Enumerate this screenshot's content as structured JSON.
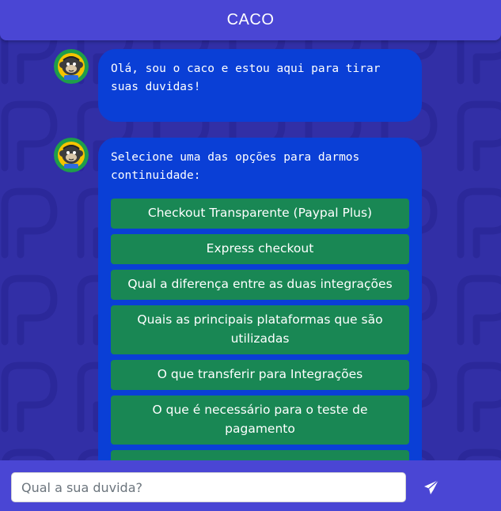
{
  "header": {
    "title": "CACO"
  },
  "messages": [
    {
      "text": "Olá, sou o caco e estou aqui para tirar suas duvidas!"
    },
    {
      "text": "Selecione uma das opções para darmos continuidade:",
      "options": [
        "Checkout Transparente (Paypal Plus)",
        "Express checkout",
        "Qual a diferença entre as duas integrações",
        "Quais as principais plataformas que são utilizadas",
        "O que transferir para Integrações",
        "O que é necessário para o teste de pagamento",
        ""
      ]
    }
  ],
  "composer": {
    "placeholder": "Qual a sua duvida?",
    "send_icon": "send-icon"
  },
  "colors": {
    "background": "#322fa6",
    "header": "#4a46d4",
    "bubble": "#0a3fd6",
    "option": "#198754"
  }
}
